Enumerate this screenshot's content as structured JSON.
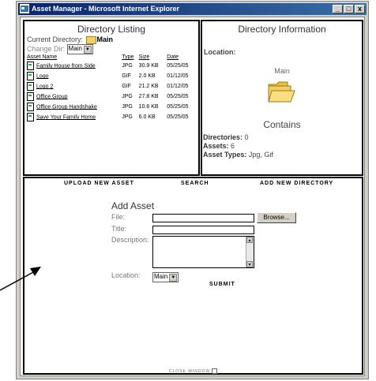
{
  "window": {
    "title": "Asset Manager - Microsoft Internet Explorer",
    "controls": {
      "minimize": "_",
      "maximize": "□",
      "close": "x"
    }
  },
  "directory_listing": {
    "title": "Directory Listing",
    "current_dir_label": "Current Directory:",
    "current_dir": "Main",
    "change_dir_label": "Change Dir:",
    "change_dir_value": "Main",
    "columns": [
      "Asset Name",
      "Type",
      "Size",
      "Date"
    ],
    "rows": [
      {
        "name": "Family House from Side",
        "type": "JPG",
        "size": "30.9 KB",
        "date": "05/25/05"
      },
      {
        "name": "Logo",
        "type": "GIF",
        "size": "2.0 KB",
        "date": "01/12/05"
      },
      {
        "name": "Logo 2",
        "type": "GIF",
        "size": "21.2 KB",
        "date": "01/12/05"
      },
      {
        "name": "Office Group",
        "type": "JPG",
        "size": "27.8 KB",
        "date": "05/25/05"
      },
      {
        "name": "Office Group Handshake",
        "type": "JPG",
        "size": "10.6 KB",
        "date": "05/25/05"
      },
      {
        "name": "Save Your Family Home",
        "type": "JPG",
        "size": "6.0 KB",
        "date": "05/25/05"
      }
    ]
  },
  "directory_info": {
    "title": "Directory Information",
    "location_label": "Location:",
    "folder_name": "Main",
    "contains_title": "Contains",
    "directories_label": "Directories:",
    "directories_value": "0",
    "assets_label": "Assets:",
    "assets_value": "6",
    "asset_types_label": "Asset Types:",
    "asset_types_value": "Jpg, Gif"
  },
  "toolbar": {
    "upload": "UPLOAD NEW ASSET",
    "search": "SEARCH",
    "add_dir": "ADD NEW DIRECTORY"
  },
  "add_asset": {
    "title": "Add Asset",
    "file_label": "File:",
    "title_label": "Title:",
    "description_label": "Description:",
    "location_label": "Location:",
    "location_value": "Main",
    "browse_label": "Browse...",
    "submit_label": "SUBMIT"
  },
  "footer": {
    "close_label": "CLOSE WINDOW"
  }
}
